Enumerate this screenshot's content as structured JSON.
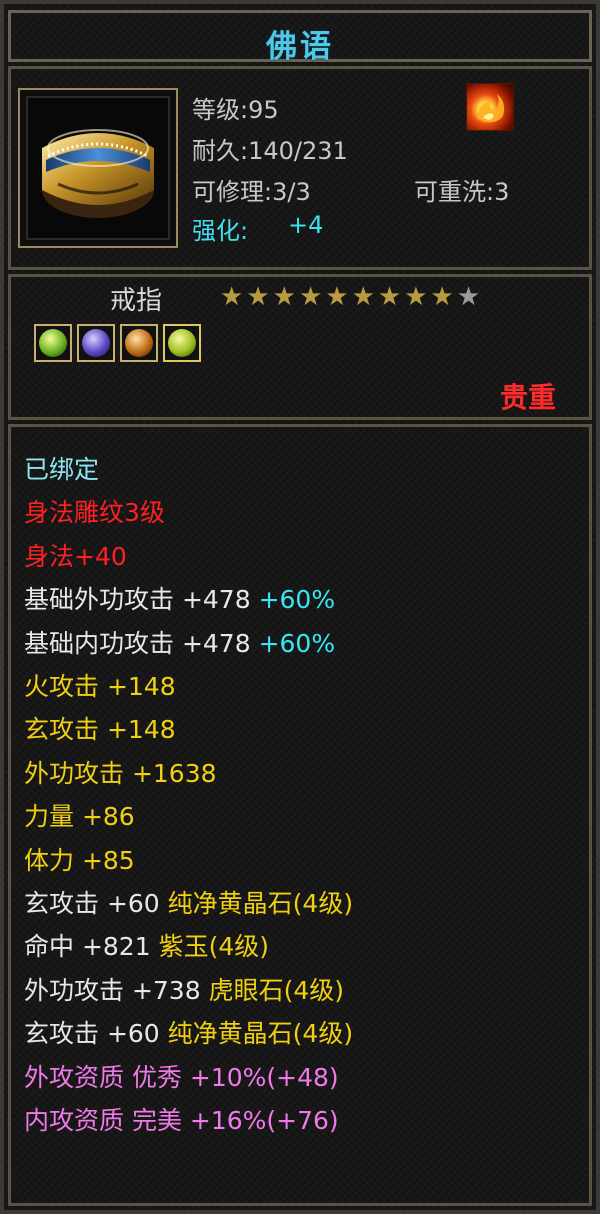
{
  "title": "佛语",
  "item": {
    "icon": "gold-ring-icon",
    "level_text": "等级:95",
    "durability_text": "耐久:140/231",
    "repair_text": "可修理:3/3",
    "rewash_text": "可重洗:3",
    "enhance_label": "强化:",
    "enhance_value": "+4",
    "badge_icon": "fire-element-icon",
    "type": "戒指",
    "stars_filled": 9,
    "stars_total": 10,
    "gems": [
      "green-gem-icon",
      "purple-gem-icon",
      "amber-gem-icon",
      "green-gem-icon"
    ],
    "rarity": "贵重"
  },
  "attributes": [
    {
      "parts": [
        {
          "text": "已绑定",
          "color": "cyan"
        }
      ]
    },
    {
      "parts": [
        {
          "text": "身法雕纹3级",
          "color": "red"
        }
      ]
    },
    {
      "parts": [
        {
          "text": "身法+40",
          "color": "red"
        }
      ]
    },
    {
      "parts": [
        {
          "text": "基础外功攻击 +478 ",
          "color": "white"
        },
        {
          "text": "+60%",
          "color": "pct"
        }
      ]
    },
    {
      "parts": [
        {
          "text": "基础内功攻击 +478 ",
          "color": "white"
        },
        {
          "text": "+60%",
          "color": "pct"
        }
      ]
    },
    {
      "parts": [
        {
          "text": "火攻击 +148",
          "color": "yellow"
        }
      ]
    },
    {
      "parts": [
        {
          "text": "玄攻击 +148",
          "color": "yellow"
        }
      ]
    },
    {
      "parts": [
        {
          "text": "外功攻击 +1638",
          "color": "yellow"
        }
      ]
    },
    {
      "parts": [
        {
          "text": "力量 +86",
          "color": "yellow"
        }
      ]
    },
    {
      "parts": [
        {
          "text": "体力 +85",
          "color": "yellow"
        }
      ]
    },
    {
      "parts": [
        {
          "text": "玄攻击 +60 ",
          "color": "white"
        },
        {
          "text": "纯净黄晶石(4级)",
          "color": "yellow"
        }
      ]
    },
    {
      "parts": [
        {
          "text": "命中 +821 ",
          "color": "white"
        },
        {
          "text": "紫玉(4级)",
          "color": "yellow"
        }
      ]
    },
    {
      "parts": [
        {
          "text": "外功攻击 +738 ",
          "color": "white"
        },
        {
          "text": "虎眼石(4级)",
          "color": "yellow"
        }
      ]
    },
    {
      "parts": [
        {
          "text": "玄攻击 +60 ",
          "color": "white"
        },
        {
          "text": "纯净黄晶石(4级)",
          "color": "yellow"
        }
      ]
    },
    {
      "parts": [
        {
          "text": "外攻资质  优秀 +10%(+48)",
          "color": "pink"
        }
      ]
    },
    {
      "parts": [
        {
          "text": "内攻资质  完美 +16%(+76)",
          "color": "pink"
        }
      ]
    }
  ]
}
